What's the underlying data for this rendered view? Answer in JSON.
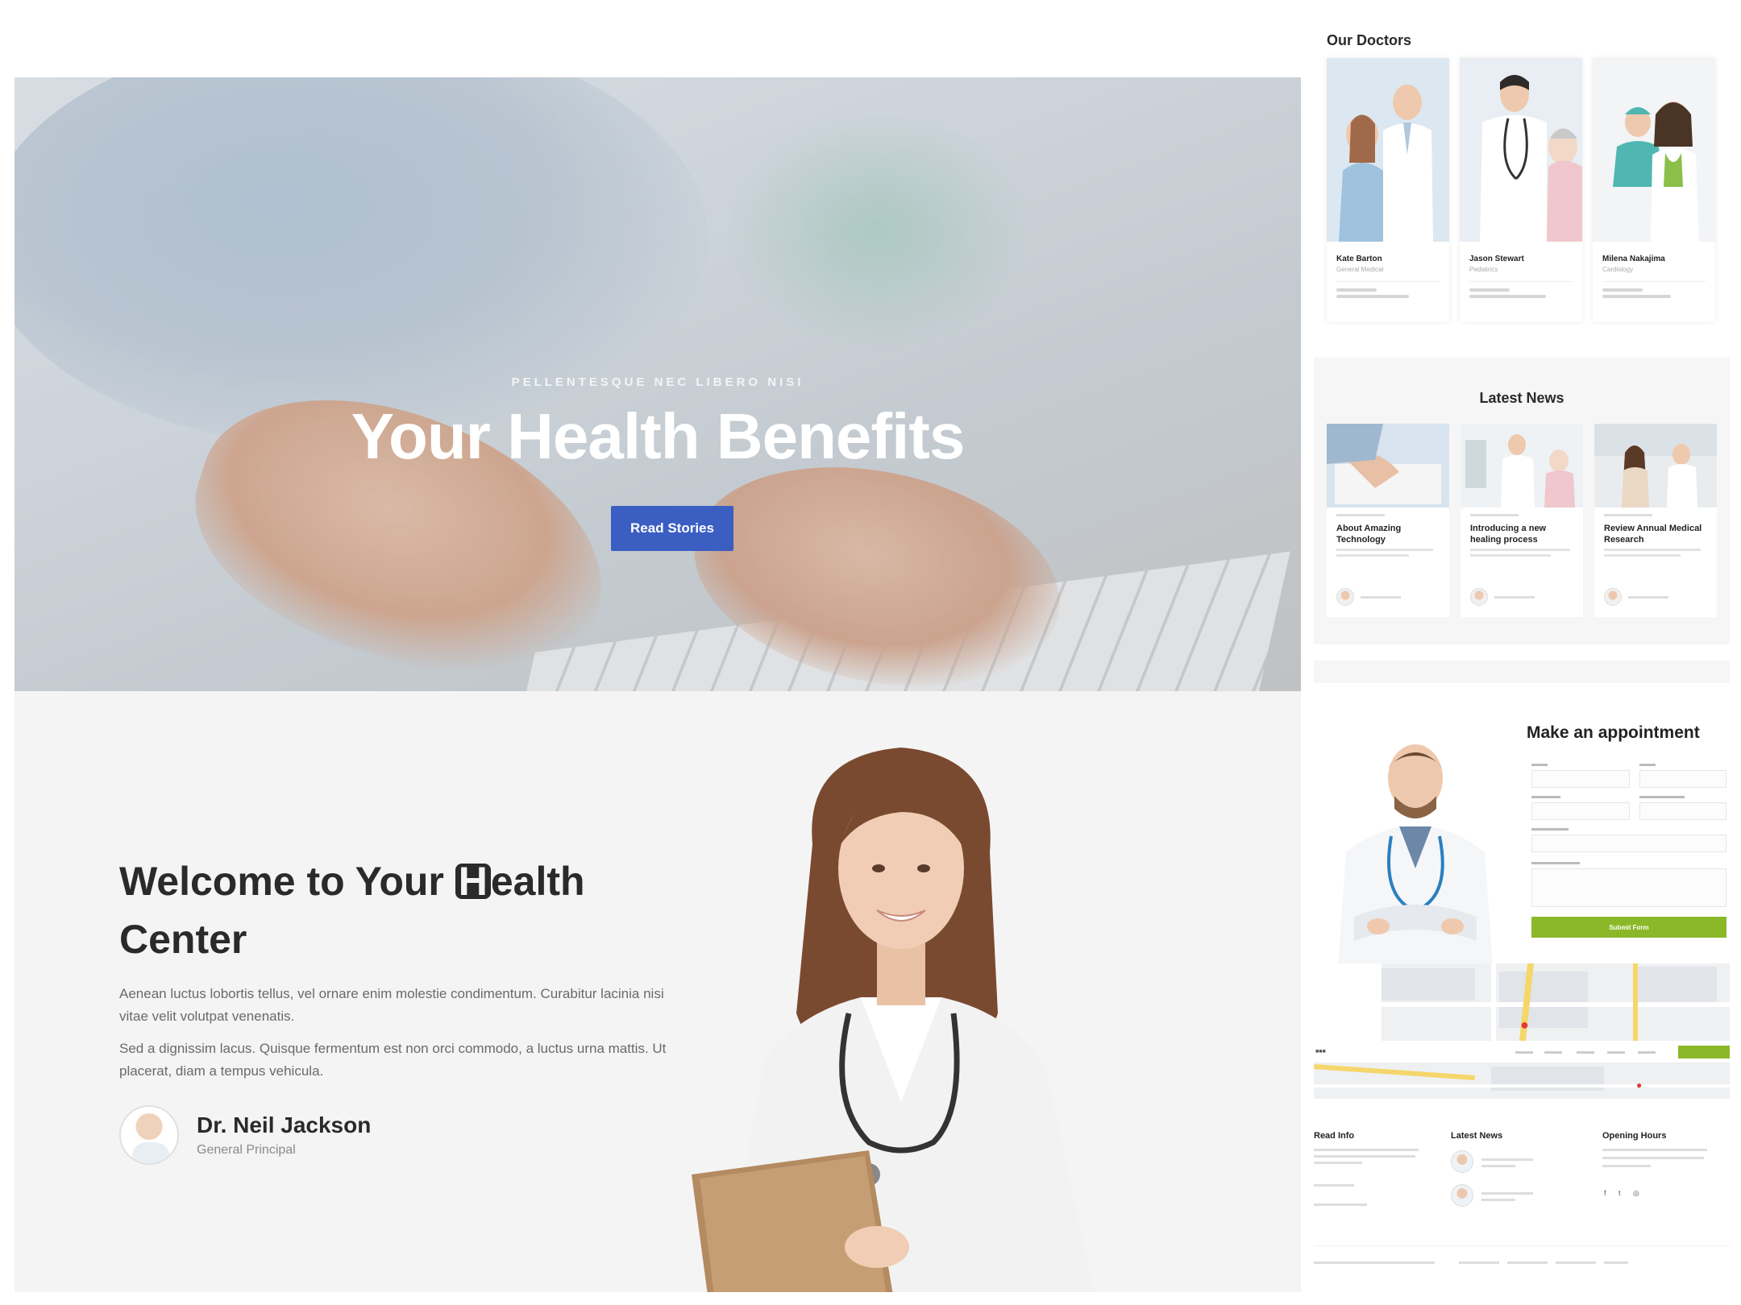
{
  "hero": {
    "kicker": "PELLENTESQUE NEC LIBERO NISI",
    "title": "Your Health Benefits",
    "button_label": "Read Stories",
    "slider_dots": 3,
    "active_dot": 3
  },
  "welcome": {
    "title_part1": "Welcome to Your ",
    "title_h": "H",
    "title_part2": "ealth",
    "title_line2": "Center",
    "paragraph1": "Aenean luctus lobortis tellus, vel ornare enim molestie condimentum. Curabitur lacinia nisi vitae velit volutpat venenatis.",
    "paragraph2": "Sed a dignissim lacus. Quisque fermentum est non orci commodo, a luctus urna mattis. Ut placerat, diam a tempus vehicula.",
    "author_name": "Dr. Neil Jackson",
    "author_role": "General Principal"
  },
  "doctors": {
    "title": "Our Doctors",
    "items": [
      {
        "name": "Kate Barton",
        "role": "General Medical"
      },
      {
        "name": "Jason Stewart",
        "role": "Pediatrics"
      },
      {
        "name": "Milena Nakajima",
        "role": "Cardiology"
      }
    ]
  },
  "news": {
    "title": "Latest News",
    "items": [
      {
        "title": "About Amazing Technology"
      },
      {
        "title": "Introducing a new healing process"
      },
      {
        "title": "Review Annual Medical Research"
      }
    ]
  },
  "appointment": {
    "title": "Make an appointment",
    "submit_label": "Submit Form"
  },
  "footer": {
    "col1_title": "Read Info",
    "col2_title": "Latest News",
    "col3_title": "Opening Hours"
  },
  "colors": {
    "hero_button": "#3b5ec2",
    "submit": "#8bb829",
    "dark_text": "#2a2a2a"
  }
}
